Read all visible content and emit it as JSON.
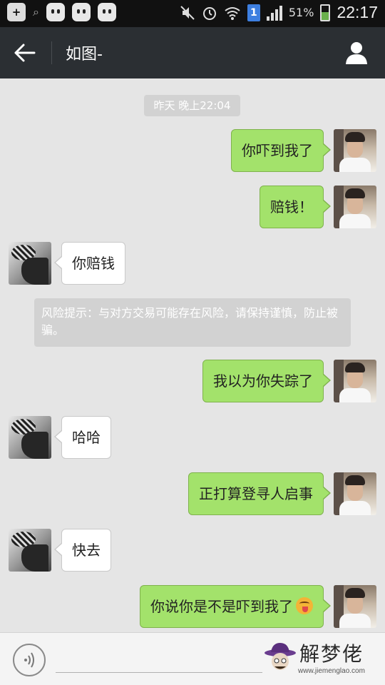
{
  "status_bar": {
    "battery_percent": "51%",
    "time": "22:17",
    "sim_label": "1",
    "icons": [
      "add-box-icon",
      "search-icon",
      "face-icon",
      "face-icon",
      "face-icon",
      "mute-icon",
      "alarm-icon",
      "wifi-icon",
      "sim-icon",
      "signal-icon",
      "battery-icon"
    ]
  },
  "header": {
    "title": "如图-",
    "back_icon": "back-arrow-icon",
    "profile_icon": "person-icon"
  },
  "chat": {
    "timestamp": "昨天 晚上22:04",
    "risk_notice": "风险提示：与对方交易可能存在风险，请保持谨慎，防止被骗。",
    "messages": [
      {
        "side": "out",
        "text": "你吓到我了"
      },
      {
        "side": "out",
        "text": "赔钱！"
      },
      {
        "side": "in",
        "text": "你赔钱"
      },
      {
        "side": "out",
        "text": "我以为你失踪了"
      },
      {
        "side": "in",
        "text": "哈哈"
      },
      {
        "side": "out",
        "text": "正打算登寻人启事"
      },
      {
        "side": "in",
        "text": "快去"
      },
      {
        "side": "out",
        "text": "你说你是不是吓到我了",
        "emoji": "tongue-out-emoji-icon"
      }
    ]
  },
  "input_bar": {
    "placeholder": "",
    "voice_icon": "voice-wave-icon"
  },
  "watermark": {
    "title": "解梦佬",
    "url": "www.jiemenglao.com"
  },
  "colors": {
    "outgoing_bubble": "#a3e26b",
    "incoming_bubble": "#ffffff",
    "title_bar": "#2b2f33",
    "chat_background": "#e5e5e5"
  }
}
